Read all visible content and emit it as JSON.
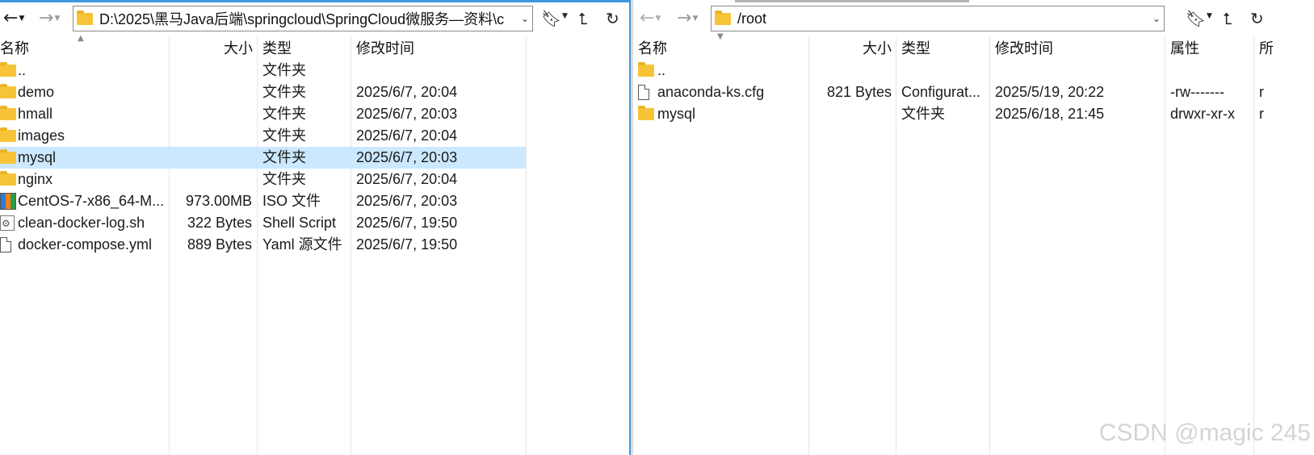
{
  "left": {
    "address": "D:\\2025\\黑马Java后端\\springcloud\\SpringCloud微服务—资料\\c",
    "columns": {
      "name": "名称",
      "size": "大小",
      "type": "类型",
      "modified": "修改时间"
    },
    "rows": [
      {
        "name": "..",
        "size": "",
        "type": "文件夹",
        "modified": "",
        "icon": "folder-icon"
      },
      {
        "name": "demo",
        "size": "",
        "type": "文件夹",
        "modified": "2025/6/7, 20:04",
        "icon": "folder-icon"
      },
      {
        "name": "hmall",
        "size": "",
        "type": "文件夹",
        "modified": "2025/6/7, 20:03",
        "icon": "folder-icon"
      },
      {
        "name": "images",
        "size": "",
        "type": "文件夹",
        "modified": "2025/6/7, 20:04",
        "icon": "folder-icon"
      },
      {
        "name": "mysql",
        "size": "",
        "type": "文件夹",
        "modified": "2025/6/7, 20:03",
        "icon": "folder-icon",
        "selected": true
      },
      {
        "name": "nginx",
        "size": "",
        "type": "文件夹",
        "modified": "2025/6/7, 20:04",
        "icon": "folder-icon"
      },
      {
        "name": "CentOS-7-x86_64-M...",
        "size": "973.00MB",
        "type": "ISO 文件",
        "modified": "2025/6/7, 20:03",
        "icon": "iso-file-icon"
      },
      {
        "name": "clean-docker-log.sh",
        "size": "322 Bytes",
        "type": "Shell Script",
        "modified": "2025/6/7, 19:50",
        "icon": "script-file-icon"
      },
      {
        "name": "docker-compose.yml",
        "size": "889 Bytes",
        "type": "Yaml 源文件",
        "modified": "2025/6/7, 19:50",
        "icon": "file-icon"
      }
    ]
  },
  "right": {
    "address": "/root",
    "columns": {
      "name": "名称",
      "size": "大小",
      "type": "类型",
      "modified": "修改时间",
      "perms": "属性",
      "extra": "所"
    },
    "rows": [
      {
        "name": "..",
        "size": "",
        "type": "",
        "modified": "",
        "perms": "",
        "extra": "",
        "icon": "folder-icon"
      },
      {
        "name": "anaconda-ks.cfg",
        "size": "821 Bytes",
        "type": "Configurat...",
        "modified": "2025/5/19, 20:22",
        "perms": "-rw-------",
        "extra": "r",
        "icon": "file-icon"
      },
      {
        "name": "mysql",
        "size": "",
        "type": "文件夹",
        "modified": "2025/6/18, 21:45",
        "perms": "drwxr-xr-x",
        "extra": "r",
        "icon": "folder-icon"
      }
    ]
  },
  "watermark": "CSDN @magic 245",
  "colors": {
    "accent": "#3c9adf",
    "selection": "#cce8ff",
    "folder": "#f7c437"
  }
}
